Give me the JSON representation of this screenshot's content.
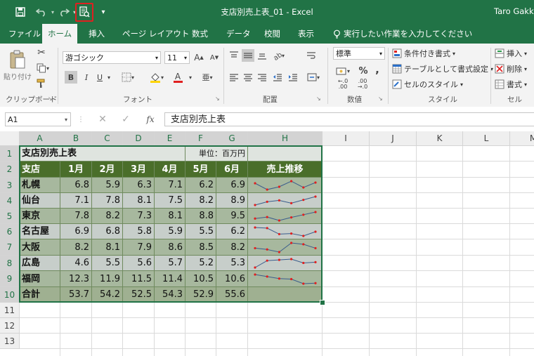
{
  "colors": {
    "excel_green": "#217346",
    "header_green": "#4a6e2a",
    "data_fill": "#a7b89e",
    "data_fill_light": "#c7ceca",
    "total_fill": "#9fb091",
    "spark_line": "#3a5c8c",
    "spark_point": "#e02020"
  },
  "titlebar": {
    "title": "支店別売上表_01 - Excel",
    "user": "Taro Gakk",
    "qat_icons": [
      "save-icon",
      "undo-icon",
      "redo-icon",
      "print-preview-icon",
      "customize-qat-icon"
    ]
  },
  "tabs": [
    "ファイル",
    "ホーム",
    "挿入",
    "ページ レイアウト",
    "数式",
    "データ",
    "校閲",
    "表示"
  ],
  "active_tab": "ホーム",
  "tell_me": "実行したい作業を入力してください",
  "ribbon": {
    "clipboard": {
      "label": "クリップボード",
      "paste": "貼り付け"
    },
    "font": {
      "label": "フォント",
      "name": "游ゴシック",
      "size": "11",
      "bold": "B",
      "italic": "I",
      "underline": "U"
    },
    "alignment": {
      "label": "配置"
    },
    "number": {
      "label": "数値",
      "format": "標準",
      "percent": "%",
      "comma": ","
    },
    "styles": {
      "label": "スタイル",
      "conditional": "条件付き書式",
      "table": "テーブルとして書式設定",
      "cell_styles": "セルのスタイル"
    },
    "cells": {
      "label": "セル",
      "insert": "挿入",
      "delete": "削除",
      "format": "書式"
    }
  },
  "formula_bar": {
    "name_box": "A1",
    "fx": "fx",
    "content": "支店別売上表"
  },
  "sheet": {
    "columns": [
      "A",
      "B",
      "C",
      "D",
      "E",
      "F",
      "G",
      "H",
      "I",
      "J",
      "K",
      "L",
      "M"
    ],
    "rows": [
      "1",
      "2",
      "3",
      "4",
      "5",
      "6",
      "7",
      "8",
      "9",
      "10",
      "11",
      "12",
      "13"
    ],
    "title": "支店別売上表",
    "unit": "単位：百万円",
    "headers": [
      "支店",
      "1月",
      "2月",
      "3月",
      "4月",
      "5月",
      "6月",
      "売上推移"
    ],
    "branches": [
      {
        "name": "札幌",
        "values": [
          "6.8",
          "5.9",
          "6.3",
          "7.1",
          "6.2",
          "6.9"
        ]
      },
      {
        "name": "仙台",
        "values": [
          "7.1",
          "7.8",
          "8.1",
          "7.5",
          "8.2",
          "8.9"
        ]
      },
      {
        "name": "東京",
        "values": [
          "7.8",
          "8.2",
          "7.3",
          "8.1",
          "8.8",
          "9.5"
        ]
      },
      {
        "name": "名古屋",
        "values": [
          "6.9",
          "6.8",
          "5.8",
          "5.9",
          "5.5",
          "6.2"
        ]
      },
      {
        "name": "大阪",
        "values": [
          "8.2",
          "8.1",
          "7.9",
          "8.6",
          "8.5",
          "8.2"
        ]
      },
      {
        "name": "広島",
        "values": [
          "4.6",
          "5.5",
          "5.6",
          "5.7",
          "5.2",
          "5.3"
        ]
      },
      {
        "name": "福岡",
        "values": [
          "12.3",
          "11.9",
          "11.5",
          "11.4",
          "10.5",
          "10.6"
        ]
      }
    ],
    "total": {
      "name": "合計",
      "values": [
        "53.7",
        "54.2",
        "52.5",
        "54.3",
        "52.9",
        "55.6"
      ]
    }
  }
}
